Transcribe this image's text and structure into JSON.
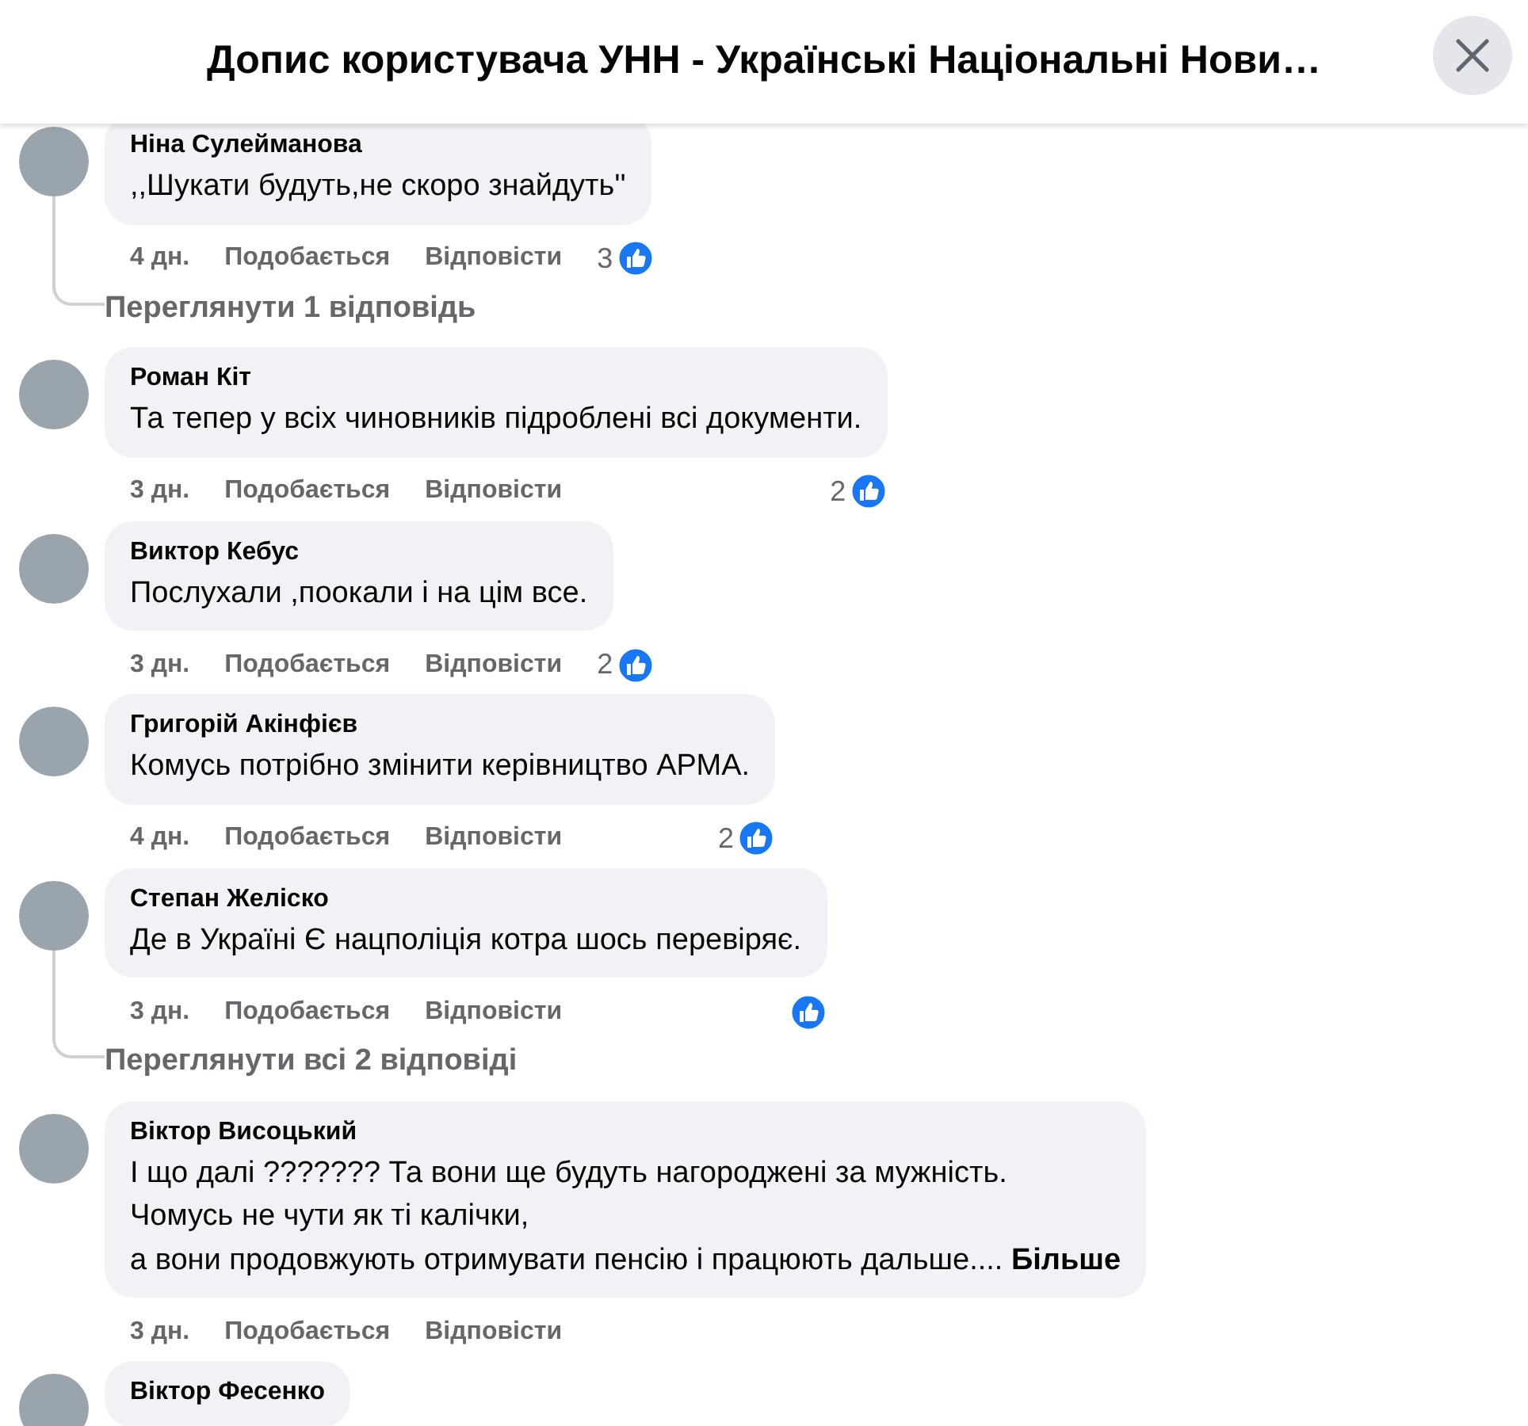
{
  "header": {
    "title": "Допис користувача УНН - Українські Національні Нови…"
  },
  "comments": [
    {
      "author": "Ніна Сулейманова",
      "text": ",,Шукати будуть,не скоро знайдуть''",
      "time": "4 дн.",
      "like_label": "Подобається",
      "reply_label": "Відповісти",
      "reacted": true,
      "reaction_count": "3",
      "replies_link": "Переглянути 1 відповідь"
    },
    {
      "author": "Роман Кіт",
      "text": "Та тепер у всіх чиновників підроблені всі документи.",
      "time": "3 дн.",
      "like_label": "Подобається",
      "reply_label": "Відповісти",
      "reacted": true,
      "reaction_count": "2"
    },
    {
      "author": "Виктор Кебус",
      "text": "Послухали ,поокали і на цім все.",
      "time": "3 дн.",
      "like_label": "Подобається",
      "reply_label": "Відповісти",
      "reacted": true,
      "reaction_count": "2"
    },
    {
      "author": "Григорій Акінфієв",
      "text": "Комусь потрібно змінити керівництво АРМА.",
      "time": "4 дн.",
      "like_label": "Подобається",
      "reply_label": "Відповісти",
      "reacted": true,
      "reaction_count": "2"
    },
    {
      "author": "Степан Желіско",
      "text": "Де в Україні Є нацполіція котра шось перевіряє.",
      "time": "3 дн.",
      "like_label": "Подобається",
      "reply_label": "Відповісти",
      "reacted": true,
      "replies_link": "Переглянути всі 2 відповіді"
    },
    {
      "author": "Віктор Висоцький",
      "text": "І що далі ??????? Та вони ще будуть нагороджені за мужність.\nЧомусь не чути як ті калічки,\nа вони продовжують отримувати пенсію і працюють дальше....",
      "more": "Більше",
      "time": "3 дн.",
      "like_label": "Подобається",
      "reply_label": "Відповісти",
      "reacted": false
    },
    {
      "author": "Віктор Фесенко"
    }
  ]
}
